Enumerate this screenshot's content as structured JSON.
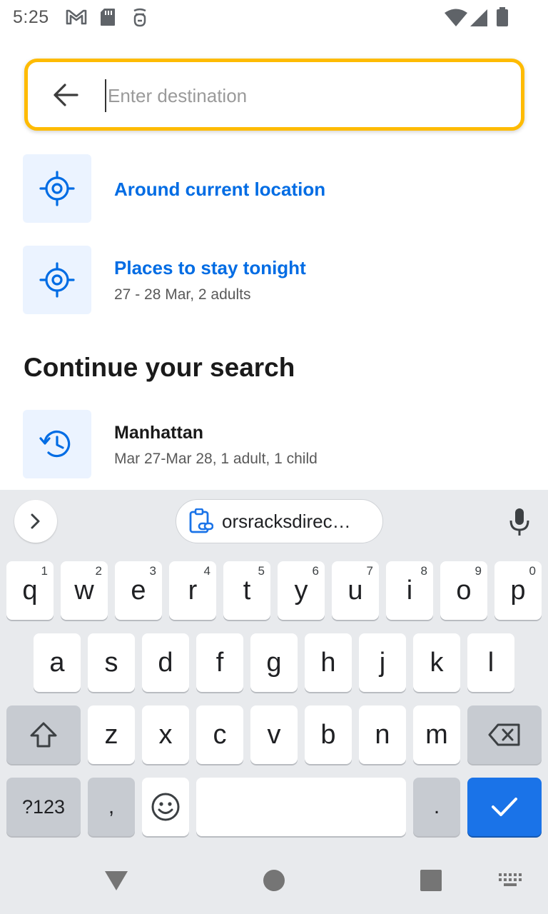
{
  "status_bar": {
    "time": "5:25",
    "icons": [
      "gmail-icon",
      "sd-card-icon",
      "vpn-icon",
      "wifi-icon",
      "signal-icon",
      "battery-icon"
    ]
  },
  "search": {
    "placeholder": "Enter destination",
    "value": "",
    "accent_color": "#febb02"
  },
  "suggestions": [
    {
      "title": "Around current location",
      "icon": "target-location-icon"
    },
    {
      "title": "Places to stay tonight",
      "subtitle": "27 - 28 Mar, 2 adults",
      "icon": "target-location-icon"
    }
  ],
  "recent": {
    "heading": "Continue your search",
    "items": [
      {
        "title": "Manhattan",
        "subtitle": "Mar 27-Mar 28, 1 adult, 1 child",
        "icon": "history-icon"
      }
    ]
  },
  "keyboard": {
    "clipboard_suggestion": "orsracksdirec…",
    "row1": [
      {
        "k": "q",
        "h": "1"
      },
      {
        "k": "w",
        "h": "2"
      },
      {
        "k": "e",
        "h": "3"
      },
      {
        "k": "r",
        "h": "4"
      },
      {
        "k": "t",
        "h": "5"
      },
      {
        "k": "y",
        "h": "6"
      },
      {
        "k": "u",
        "h": "7"
      },
      {
        "k": "i",
        "h": "8"
      },
      {
        "k": "o",
        "h": "9"
      },
      {
        "k": "p",
        "h": "0"
      }
    ],
    "row2": [
      "a",
      "s",
      "d",
      "f",
      "g",
      "h",
      "j",
      "k",
      "l"
    ],
    "row3": [
      "z",
      "x",
      "c",
      "v",
      "b",
      "n",
      "m"
    ],
    "symbols_label": "?123",
    "comma_label": ",",
    "period_label": ".",
    "colors": {
      "key": "#ffffff",
      "modifier": "#c7cbd1",
      "action": "#1a73e8",
      "background": "#e8eaed"
    }
  },
  "brand_colors": {
    "primary_blue": "#006ce4",
    "icon_box_bg": "#ebf3ff"
  }
}
